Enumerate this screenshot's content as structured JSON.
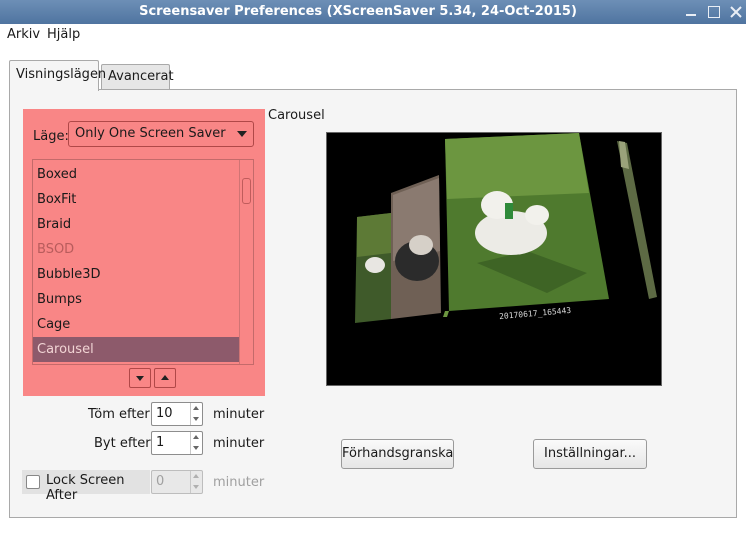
{
  "window": {
    "title": "Screensaver Preferences  (XScreenSaver 5.34, 24-Oct-2015)"
  },
  "menu": {
    "items": [
      "Arkiv",
      "Hjälp"
    ]
  },
  "tabs": [
    {
      "label": "Visningslägen",
      "active": true
    },
    {
      "label": "Avancerat",
      "active": false
    }
  ],
  "mode": {
    "label": "Läge:",
    "value": "Only One Screen Saver"
  },
  "savers": {
    "items": [
      "Boxed",
      "BoxFit",
      "Braid",
      "BSOD",
      "Bubble3D",
      "Bumps",
      "Cage",
      "Carousel"
    ],
    "disabled": [
      "BSOD"
    ],
    "selected": "Carousel"
  },
  "blank_after": {
    "label": "Töm efter",
    "value": "10",
    "unit": "minuter"
  },
  "cycle_after": {
    "label": "Byt efter",
    "value": "1",
    "unit": "minuter"
  },
  "lock": {
    "label": "Lock Screen After",
    "value": "0",
    "unit": "minuter",
    "checked": false
  },
  "preview": {
    "title": "Carousel",
    "caption": "20170617_165443"
  },
  "buttons": {
    "preview": "Förhandsgranska",
    "settings": "Inställningar..."
  },
  "colors": {
    "titlebar": "#5a7eaa",
    "highlight": "#f98686",
    "selected_row": "#8d5a6b"
  }
}
